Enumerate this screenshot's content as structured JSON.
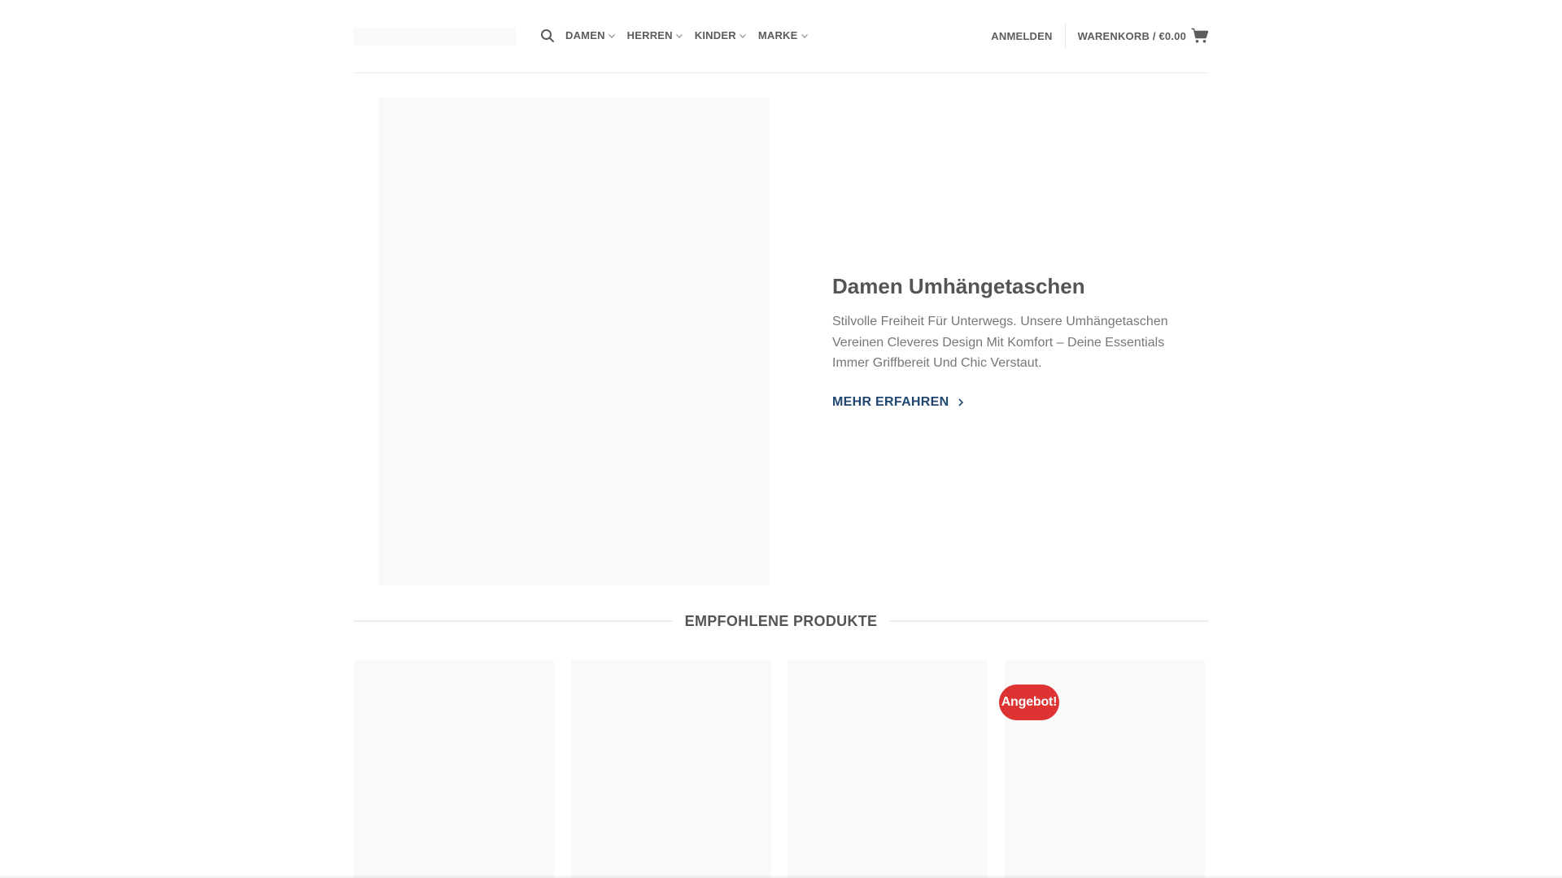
{
  "header": {
    "nav": [
      {
        "label": "DAMEN"
      },
      {
        "label": "HERREN"
      },
      {
        "label": "KINDER"
      },
      {
        "label": "MARKE"
      }
    ],
    "login_label": "ANMELDEN",
    "cart_label": "WARENKORB / €0.00"
  },
  "hero": {
    "title": "Damen Umhängetaschen",
    "description": "Stilvolle Freiheit Für Unterwegs. Unsere Umhängetaschen Vereinen Cleveres Design Mit Komfort – Deine Essentials Immer Griffbereit Und Chic Verstaut.",
    "cta_label": "MEHR ERFAHREN"
  },
  "featured": {
    "title": "EMPFOHLENE PRODUKTE",
    "sale_badge": "Angebot!"
  },
  "icons": {
    "search": "search-icon",
    "dropdown": "chevron-down-icon",
    "cart": "cart-icon",
    "cta": "chevron-right-icon"
  },
  "colors": {
    "link_accent": "#1f4670",
    "sale_badge": "#dd3333",
    "placeholder": "#f8f9f9"
  }
}
